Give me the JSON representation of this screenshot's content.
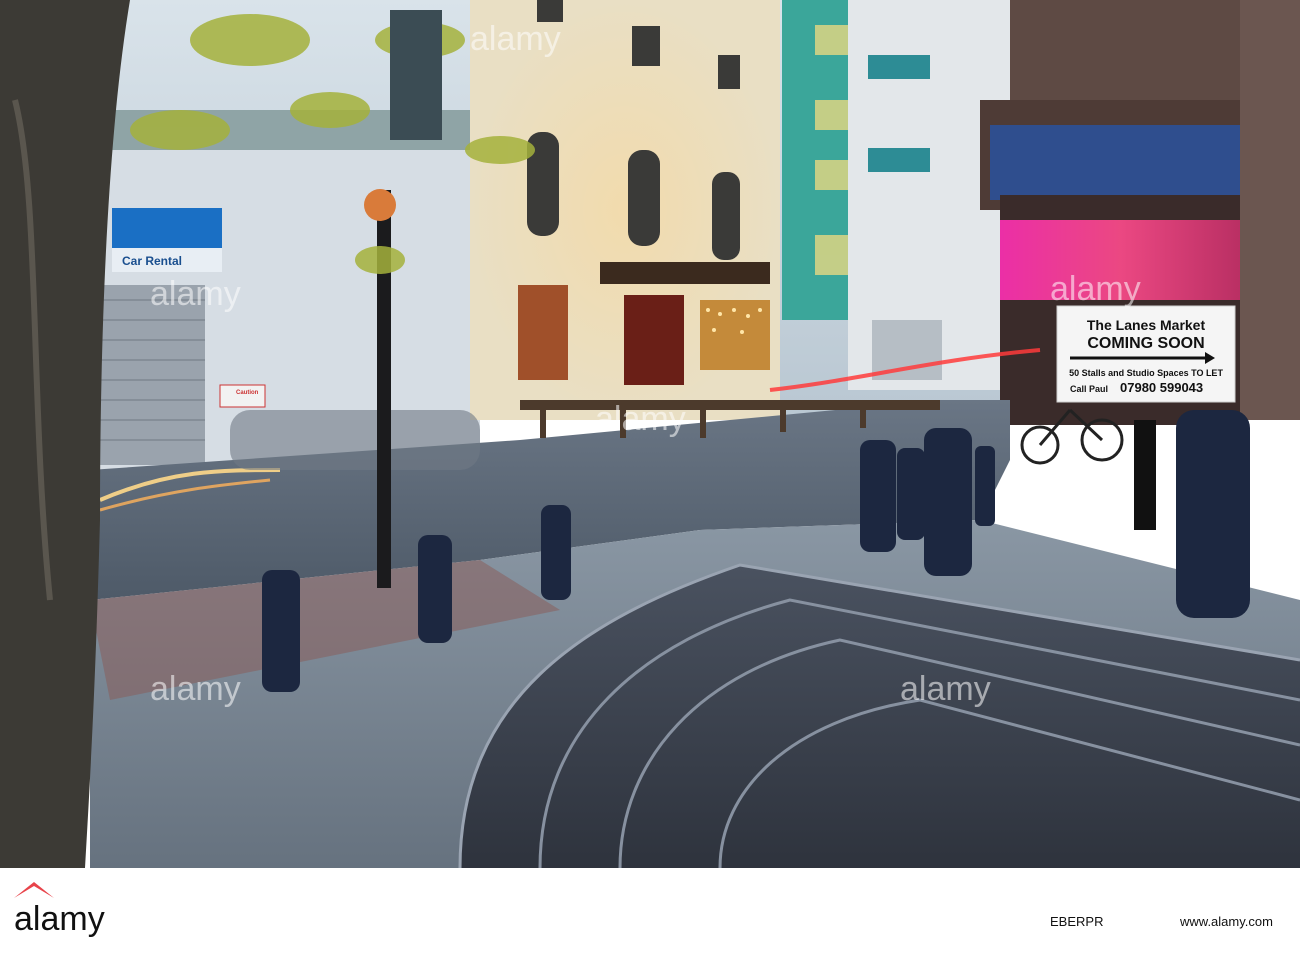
{
  "scene": {
    "description_tag": "street-scene-dusk",
    "colors": {
      "sky": "#c9d6df",
      "pavement": "#7d8c9a",
      "road": "#5b6775",
      "bollard": "#1c2740",
      "neon_pink": "#ff3fa8",
      "pub_glow": "#f4b35a"
    }
  },
  "shop_sign": {
    "text": "Car Rental"
  },
  "caution_sign": {
    "text": "Caution"
  },
  "market_sign": {
    "line1": "The Lanes Market",
    "line2": "COMING SOON",
    "line3": "50 Stalls and Studio Spaces TO LET",
    "line4": "Call Paul",
    "phone": "07980 599043"
  },
  "watermarks": [
    "alamy",
    "alamy",
    "alamy",
    "alamy",
    "alamy",
    "alamy"
  ],
  "footer": {
    "logo": "alamy",
    "image_id": "EBERPR",
    "url": "www.alamy.com"
  }
}
